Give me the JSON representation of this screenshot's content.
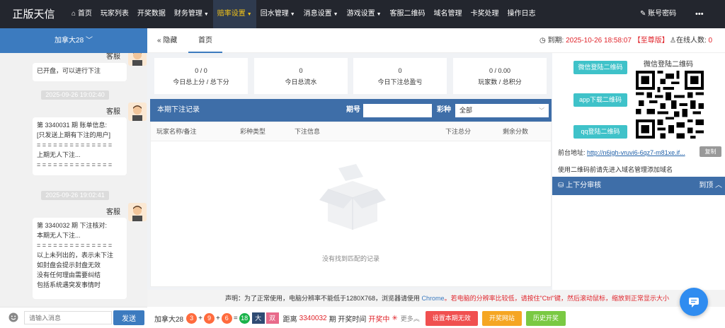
{
  "brand": "正版天信",
  "nav": {
    "items": [
      {
        "label": "首页"
      },
      {
        "label": "玩家列表"
      },
      {
        "label": "开奖数据"
      },
      {
        "label": "财务管理"
      },
      {
        "label": "赔率设置"
      },
      {
        "label": "回水管理"
      },
      {
        "label": "消息设置"
      },
      {
        "label": "游戏设置"
      },
      {
        "label": "客服二维码"
      },
      {
        "label": "域名管理"
      },
      {
        "label": "卡奖处理"
      },
      {
        "label": "操作日志"
      }
    ],
    "account": "账号密码",
    "more": "•••"
  },
  "chat": {
    "region": "加拿大28",
    "messages": [
      {
        "sender": "客服",
        "text": "已开盘，可以进行下注"
      },
      {
        "time": "2025-09-26 19:02:40",
        "sender": "客服",
        "text": "第 3340031 期 账单信息:\n[只发送上期有下注的用户]\n= = = = = = = = = = = = = =\n上期无人下注...\n= = = = = = = = = = = = = ="
      },
      {
        "time": "2025-09-26 19:02:41",
        "sender": "客服",
        "text": "第 3340032 期 下注核对:\n本期无人下注...\n= = = = = = = = = = = = = =\n以上未列出的，表示未下注\n如封盘会提示封盘无效\n没有任何理由需要纠结\n包括系统遇突发事情时"
      }
    ],
    "input_placeholder": "请输入消息",
    "send_label": "发送"
  },
  "tabs": {
    "hide_label": "隐藏",
    "home_label": "首页"
  },
  "header": {
    "expire_label": "到期:",
    "expire_date": "2025-10-26 18:58:07",
    "tier": "【至尊版】",
    "online_label": "在线人数:",
    "online_count": "0"
  },
  "stats": [
    {
      "value": "0 / 0",
      "label": "今日总上分 / 总下分"
    },
    {
      "value": "0",
      "label": "今日总流水"
    },
    {
      "value": "0",
      "label": "今日下注总盈亏"
    },
    {
      "value": "0 / 0.00",
      "label": "玩家数 / 总积分"
    }
  ],
  "records": {
    "title": "本期下注记录",
    "period_label": "期号",
    "period_value": "",
    "game_label": "彩种",
    "game_value": "全部",
    "columns": [
      "玩家名称/备注",
      "彩种类型",
      "下注信息",
      "下注总分",
      "剩余分数"
    ],
    "empty_text": "没有找到匹配的记录"
  },
  "side": {
    "wx_btn": "微信登陆二维码",
    "app_btn": "app下载二维码",
    "qq_btn": "qq登陆二维码",
    "qr_title": "微信登陆二维码",
    "front_label": "前台地址:",
    "front_url": "http://n6igh-vruvi6-6qz7-m81xe.if...",
    "copy_label": "复制",
    "hint": "使用二维码前请先进入域名管理添加域名",
    "audit_title": "上下分审核",
    "audit_top": "到顶"
  },
  "notice": {
    "prefix": "声明：为了正常使用，电脑分辨率不能低于1280X768，浏览器请使用 ",
    "browser": "Chrome",
    "suffix": "。若电脑的分辨率比较低，请按住\"Ctrl\"键，然后滚动鼠标，缩放到正常显示大小"
  },
  "bottom": {
    "game": "加拿大28",
    "balls": [
      "3",
      "9",
      "6",
      "18"
    ],
    "ball_colors": [
      "#ff6b3d",
      "#ff6b3d",
      "#ff6b3d",
      "#19b34a"
    ],
    "size_tag": "大",
    "parity_tag": "双",
    "distance_label": "距离",
    "period": "3340032",
    "period_suffix": "期 开奖时间",
    "status": "开奖中",
    "more": "更多",
    "btn_invalid": "设置本期无效",
    "btn_site": "开奖网站",
    "btn_history": "历史开奖"
  },
  "colors": {
    "topbar": "#23262e",
    "accent": "#3c7bbf",
    "active_nav_text": "#f5c518",
    "danger": "#e0242b"
  }
}
